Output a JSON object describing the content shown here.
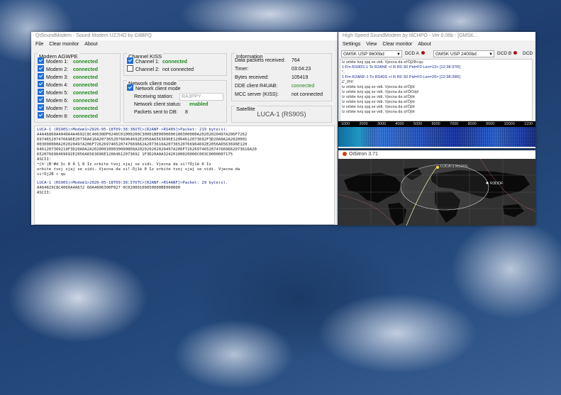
{
  "main_window": {
    "title": "QtSoundModem - Sound Modem UZ7HO by G8BPQ",
    "menu": [
      "File",
      "Clear monitor",
      "About"
    ],
    "modem_group": {
      "title": "Modem AGWPE",
      "items": [
        {
          "label": "Modem 1:",
          "status": "connected"
        },
        {
          "label": "Modem 2:",
          "status": "connected"
        },
        {
          "label": "Modem 3:",
          "status": "connected"
        },
        {
          "label": "Modem 4:",
          "status": "connected"
        },
        {
          "label": "Modem 5:",
          "status": "connected"
        },
        {
          "label": "Modem 6:",
          "status": "connected"
        },
        {
          "label": "Modem 7:",
          "status": "connected"
        },
        {
          "label": "Modem 8:",
          "status": "connected"
        }
      ]
    },
    "kiss_group": {
      "title": "Channel KISS",
      "items": [
        {
          "label": "Channel 1:",
          "status": "connected",
          "checked": true
        },
        {
          "label": "Channel 2:",
          "status": "not connected",
          "checked": false
        }
      ]
    },
    "network_group": {
      "title": "Network client mode",
      "checkbox_label": "Network client mode",
      "receiving_station_label": "Receiving station:",
      "receiving_station_value": "RA3PPY",
      "status_label": "Network client status:",
      "status_value": "enabled",
      "packets_label": "Packets sent to DB:",
      "packets_value": "8"
    },
    "info_group": {
      "title": "Information",
      "rows": [
        {
          "label": "Data packets received:",
          "value": "764"
        },
        {
          "label": "Timer:",
          "value": "03:04:23"
        },
        {
          "label": "Bytes received:",
          "value": "105419"
        },
        {
          "label": "DDE client R4UAB:",
          "value": "connected"
        },
        {
          "label": "MCC server (KISS):",
          "value": "not connected"
        }
      ]
    },
    "satellite_group": {
      "title": "Satellite",
      "value": "LUCA-1 (RS90S)"
    },
    "log": [
      {
        "type": "hdr",
        "text": "LUCA-1 (RS90S)>Modem1>2026-05-18T09:38:36UTC>[R2ANF->RS40S]>Packet: 219 byte(s)."
      },
      {
        "type": "hex",
        "text": "A4A46860A4040A4A4692C8C40630DF0240C01000200C30001BE0000000100300000A20202020497A206F7262"
      },
      {
        "type": "hex",
        "text": "697465207476696E20736A616A20736520766964692E2056A6563696E12064612073692F3D20A0A2A2020001"
      },
      {
        "type": "hex",
        "text": "0030000D0A202020497A206F726269746520747669662A2073616A20736520766964692E2056A6563696E120"
      },
      {
        "type": "hex",
        "text": "6461207369219F3D20A0A2A2020001000300000D0A202020202020497A206F726269746520747669662073616A20"
      },
      {
        "type": "hex",
        "text": "652076696469692E2056A6563696E12064612073692 1F3D20A0A32420100020000C003C0000007175"
      },
      {
        "type": "label",
        "text": "ASCII:"
      },
      {
        "type": "text",
        "text": "¬[h'|B'#d   §c 8  Ã ¾  0      Iz orbite tvoj sjaj se vidi. Vjecna da si!?Ójîé  0      Iz"
      },
      {
        "type": "text",
        "text": "orbite tvoj sjaj se vidi. Vjecna da si!-Ójîé   0      Iz orbite tvoj sjaj se vidi. Vjecna da"
      },
      {
        "type": "text",
        "text": "si!Ój2B    <    qu"
      },
      {
        "type": "sep",
        "text": ""
      },
      {
        "type": "hdr",
        "text": "LUCA-1 (RS90S)>Modem1>2026-05-18T09:38:37UTC>[R2ANF->RS4ANF]>Packet: 29 byte(s)."
      },
      {
        "type": "hex",
        "text": "A464829C8C4060A4A672 60A4606300F027 0C02000100050000BE000000"
      },
      {
        "type": "label",
        "text": "ASCII:"
      }
    ]
  },
  "hs_window": {
    "title": "High-Speed SoundModem by I8CHPO - Ver 0.06b - [GMSK...",
    "menu": [
      "Settings",
      "View",
      "Clear monitor",
      "About"
    ],
    "select_a": "GMSK USP 9600bd",
    "dcd_a": "DCD A",
    "select_b": "GMSK USP 2400bd",
    "dcd_b": "DCD B",
    "dcd_c": "DCD",
    "lines": [
      "   Iz orbite tvoj sjaj se vidi. Vjecna da si!Ój2B<qu",
      "1:Fm RS90S-1 To R2ANF <I R R0 S0 Pid=F0 Len=13> [12:38:37R]",
      "°,",
      "1:Fm R2ANF-1 To RS40S <I R R0 S0 Pid=F0 Len=20> [12:38:39R]",
      "£'_Pîìî´",
      "   Iz orbite tvoj sjaj se vidi. Vjecna da si!Ójîé",
      "   Iz orbite tvoj sjaj se vidi. Vjecna da si!ÓCéjé",
      "   Iz orbite tvoj sjaj se vidi. Vjecna da si!Ójîé",
      "   Iz orbite tvoj sjaj se vidi. Vjecna da si!Ójîé",
      "   Iz orbite tvoj sjaj se vidi. Vjecna da si!Ójîé",
      "   Iz orbite tvoj sjaj se vidi. Vjecna da si!Ójîé"
    ],
    "scale": [
      "1000",
      "2000",
      "3000",
      "4000",
      "5000",
      "6000",
      "7000",
      "8000",
      "9000",
      "10000",
      "1100"
    ]
  },
  "orbitron": {
    "title": "Orbitron 3.71",
    "sat_label": "LUCA-1 RS90S",
    "station_label": "R3DDF"
  },
  "colors": {
    "connected": "#1e8a1e",
    "checkbox": "#1e6fd9",
    "dcd_led": "#b01010"
  }
}
